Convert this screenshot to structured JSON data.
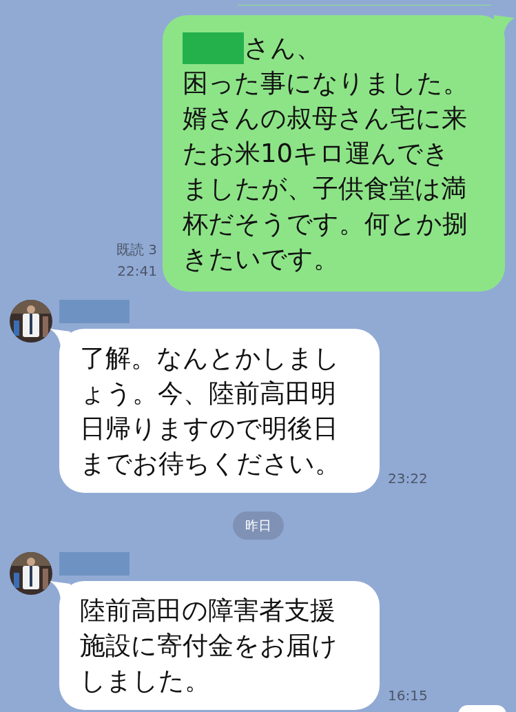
{
  "messages": [
    {
      "kind": "outgoing",
      "redacted_prefix": true,
      "greeting": "さん、",
      "text": "困った事になりました。婿さんの叔母さん宅に来たお米10キロ運んできましたが、子供食堂は満杯だそうです。何とか捌きたいです。",
      "read_label": "既読 3",
      "time": "22:41"
    },
    {
      "kind": "incoming",
      "sender_redacted": true,
      "text": "了解。なんとかしましょう。今、陸前高田明日帰りますので明後日までお待ちください。",
      "time": "23:22"
    },
    {
      "kind": "date",
      "text": "昨日"
    },
    {
      "kind": "incoming",
      "sender_redacted": true,
      "text": "陸前高田の障害者支援施設に寄付金をお届けしました。",
      "time": "16:15"
    }
  ]
}
